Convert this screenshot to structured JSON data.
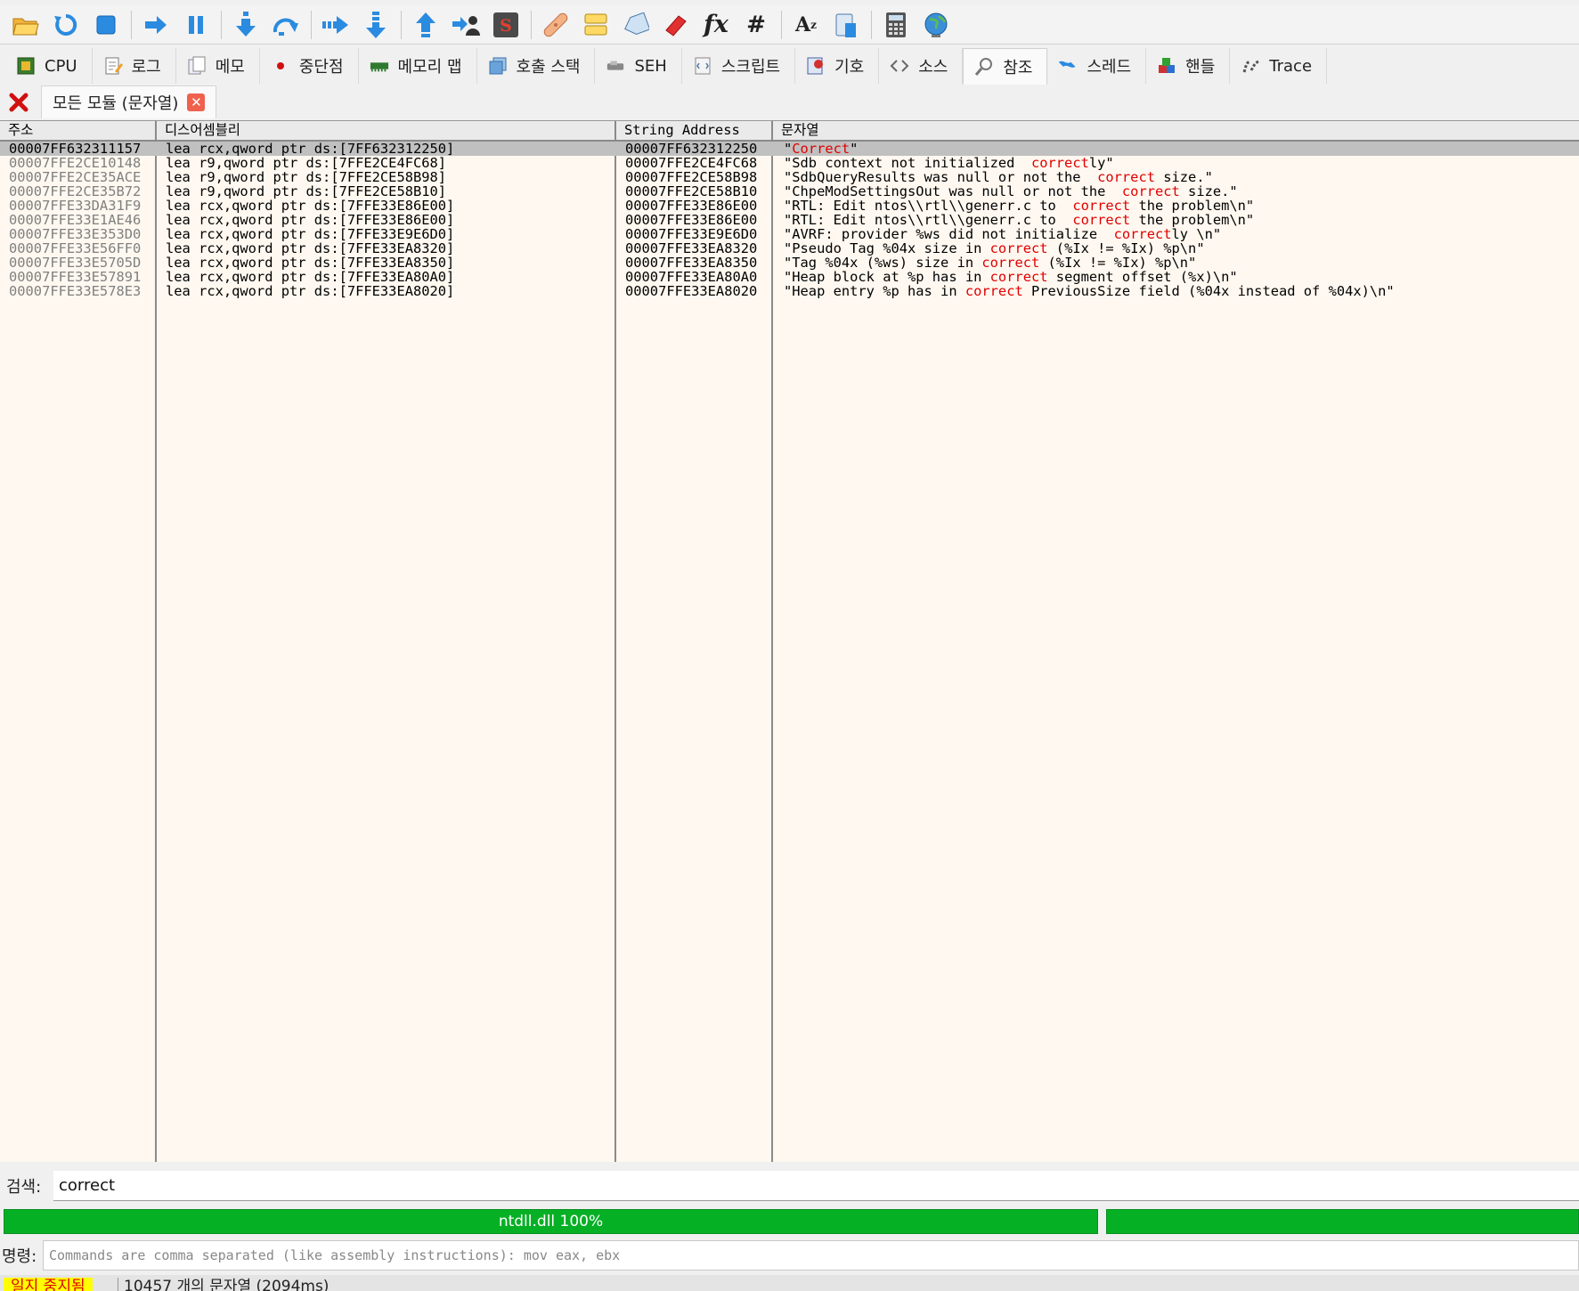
{
  "toolbar": {
    "buttons": [
      "open-icon",
      "restart-icon",
      "stop-icon",
      "run-icon",
      "pause-icon",
      "step-into-icon",
      "step-over-icon",
      "trace-into-icon",
      "trace-over-icon",
      "execute-till-return-icon",
      "run-to-user-code-icon",
      "scylla-icon",
      "patch-icon",
      "comment-icon",
      "label-icon",
      "bookmark-icon",
      "function-icon",
      "hash-icon",
      "font-icon",
      "device-icon",
      "calculator-icon",
      "globe-icon"
    ],
    "fx_label": "fx",
    "hash_label": "#",
    "az_label": "A",
    "az_sub": "z"
  },
  "tabs": [
    {
      "id": "cpu",
      "label": "CPU",
      "icon": "cpu-icon"
    },
    {
      "id": "log",
      "label": "로그",
      "icon": "log-icon"
    },
    {
      "id": "notes",
      "label": "메모",
      "icon": "notes-icon"
    },
    {
      "id": "breakpoints",
      "label": "중단점",
      "icon": "breakpoint-icon"
    },
    {
      "id": "memory-map",
      "label": "메모리 맵",
      "icon": "memory-map-icon"
    },
    {
      "id": "call-stack",
      "label": "호출 스택",
      "icon": "call-stack-icon"
    },
    {
      "id": "seh",
      "label": "SEH",
      "icon": "seh-icon"
    },
    {
      "id": "script",
      "label": "스크립트",
      "icon": "script-icon"
    },
    {
      "id": "symbols",
      "label": "기호",
      "icon": "symbols-icon"
    },
    {
      "id": "source",
      "label": "소스",
      "icon": "source-icon"
    },
    {
      "id": "references",
      "label": "참조",
      "icon": "references-icon",
      "active": true
    },
    {
      "id": "threads",
      "label": "스레드",
      "icon": "threads-icon"
    },
    {
      "id": "handles",
      "label": "핸들",
      "icon": "handles-icon"
    },
    {
      "id": "trace",
      "label": "Trace",
      "icon": "trace-icon"
    }
  ],
  "subtab": {
    "label": "모든 모듈 (문자열)"
  },
  "columns": [
    "주소",
    "디스어셈블리",
    "String Address",
    "문자열"
  ],
  "highlight": "correct",
  "rows": [
    {
      "addr": "00007FF632311157",
      "dis": "lea rcx,qword ptr ds:[7FF632312250]",
      "saddr": "00007FF632312250",
      "str": [
        "\"",
        "Correct",
        "\""
      ],
      "selected": true
    },
    {
      "addr": "00007FFE2CE10148",
      "dis": "lea r9,qword ptr ds:[7FFE2CE4FC68]",
      "saddr": "00007FFE2CE4FC68",
      "str": [
        "\"Sdb context not initialized  ",
        "correct",
        "ly\""
      ]
    },
    {
      "addr": "00007FFE2CE35ACE",
      "dis": "lea r9,qword ptr ds:[7FFE2CE58B98]",
      "saddr": "00007FFE2CE58B98",
      "str": [
        "\"SdbQueryResults was null or not the  ",
        "correct",
        " size.\""
      ]
    },
    {
      "addr": "00007FFE2CE35B72",
      "dis": "lea r9,qword ptr ds:[7FFE2CE58B10]",
      "saddr": "00007FFE2CE58B10",
      "str": [
        "\"ChpeModSettingsOut was null or not the  ",
        "correct",
        " size.\""
      ]
    },
    {
      "addr": "00007FFE33DA31F9",
      "dis": "lea rcx,qword ptr ds:[7FFE33E86E00]",
      "saddr": "00007FFE33E86E00",
      "str": [
        "\"RTL: Edit ntos\\\\rtl\\\\generr.c to  ",
        "correct",
        " the problem\\n\""
      ]
    },
    {
      "addr": "00007FFE33E1AE46",
      "dis": "lea rcx,qword ptr ds:[7FFE33E86E00]",
      "saddr": "00007FFE33E86E00",
      "str": [
        "\"RTL: Edit ntos\\\\rtl\\\\generr.c to  ",
        "correct",
        " the problem\\n\""
      ]
    },
    {
      "addr": "00007FFE33E353D0",
      "dis": "lea rcx,qword ptr ds:[7FFE33E9E6D0]",
      "saddr": "00007FFE33E9E6D0",
      "str": [
        "\"AVRF: provider %ws did not initialize  ",
        "correct",
        "ly \\n\""
      ]
    },
    {
      "addr": "00007FFE33E56FF0",
      "dis": "lea rcx,qword ptr ds:[7FFE33EA8320]",
      "saddr": "00007FFE33EA8320",
      "str": [
        "\"Pseudo Tag %04x size in ",
        "correct",
        " (%Ix != %Ix) %p\\n\""
      ]
    },
    {
      "addr": "00007FFE33E5705D",
      "dis": "lea rcx,qword ptr ds:[7FFE33EA8350]",
      "saddr": "00007FFE33EA8350",
      "str": [
        "\"Tag %04x (%ws) size in ",
        "correct",
        " (%Ix != %Ix) %p\\n\""
      ]
    },
    {
      "addr": "00007FFE33E57891",
      "dis": "lea rcx,qword ptr ds:[7FFE33EA80A0]",
      "saddr": "00007FFE33EA80A0",
      "str": [
        "\"Heap block at %p has in ",
        "correct",
        " segment offset (%x)\\n\""
      ]
    },
    {
      "addr": "00007FFE33E578E3",
      "dis": "lea rcx,qword ptr ds:[7FFE33EA8020]",
      "saddr": "00007FFE33EA8020",
      "str": [
        "\"Heap entry %p has in ",
        "correct",
        " PreviousSize field (%04x instead of %04x)\\n\""
      ]
    }
  ],
  "search": {
    "label": "검색:",
    "value": "correct"
  },
  "progress": {
    "label": "ntdll.dll 100%",
    "value": 1.0
  },
  "command": {
    "label": "명령:",
    "placeholder": "Commands are comma separated (like assembly instructions): mov eax, ebx"
  },
  "status": {
    "state": "일지 중지됨",
    "text": "10457 개의 문자열 (2094ms)"
  },
  "colors": {
    "highlight": "#e00000",
    "progress": "#06b025",
    "row_bg": "#fff8f0",
    "selected_row": "#c0c0c0"
  }
}
